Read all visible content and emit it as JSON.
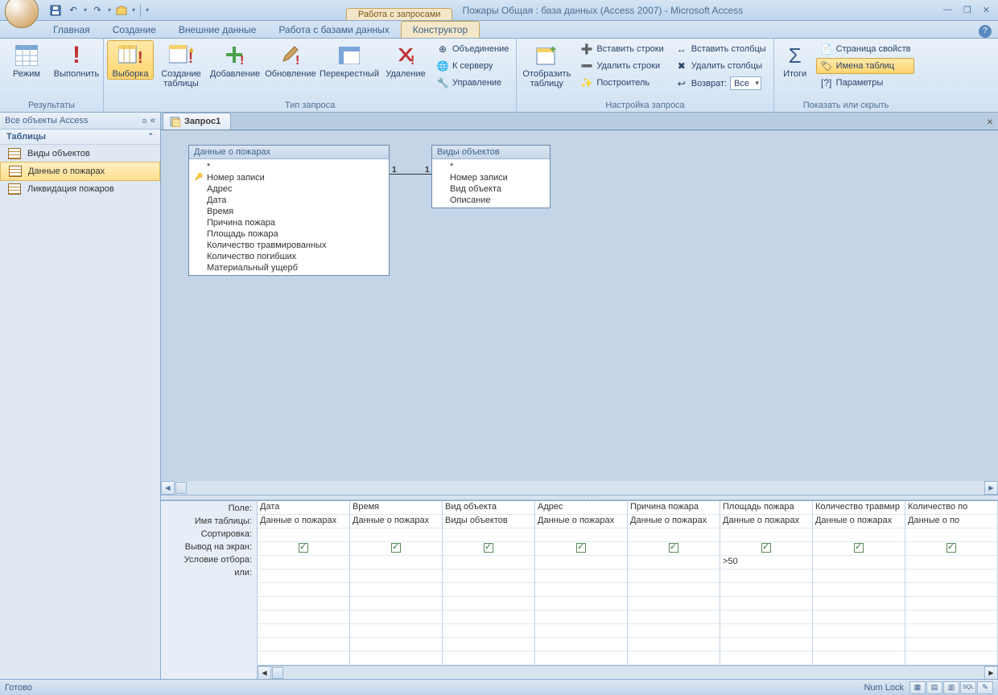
{
  "context_tab_label": "Работа с запросами",
  "app_title": "Пожары Общая : база данных (Access 2007) - Microsoft Access",
  "tabs": {
    "home": "Главная",
    "create": "Создание",
    "external": "Внешние данные",
    "dbtools": "Работа с базами данных",
    "design": "Конструктор"
  },
  "ribbon": {
    "results_group": "Результаты",
    "view": "Режим",
    "run": "Выполнить",
    "qtype_group": "Тип запроса",
    "select": "Выборка",
    "maketable": "Создание таблицы",
    "append": "Добавление",
    "update": "Обновление",
    "crosstab": "Перекрестный",
    "delete": "Удаление",
    "union": "Объединение",
    "passthrough": "К серверу",
    "datadef": "Управление",
    "setup_group": "Настройка запроса",
    "showtable": "Отобразить таблицу",
    "insrows": "Вставить строки",
    "delrows": "Удалить строки",
    "builder": "Построитель",
    "inscols": "Вставить столбцы",
    "delcols": "Удалить столбцы",
    "return_lbl": "Возврат:",
    "return_val": "Все",
    "totals": "Итоги",
    "propsheet": "Страница свойств",
    "tablenames": "Имена таблиц",
    "params": "Параметры",
    "showhide_group": "Показать или скрыть"
  },
  "nav": {
    "header": "Все объекты Access",
    "group": "Таблицы",
    "items": [
      "Виды объектов",
      "Данные о пожарах",
      "Ликвидация пожаров"
    ]
  },
  "doc_tab": "Запрос1",
  "table1": {
    "title": "Данные о пожарах",
    "fields": [
      "*",
      "Номер записи",
      "Адрес",
      "Дата",
      "Время",
      "Причина пожара",
      "Площадь пожара",
      "Количество травмированных",
      "Количество погибших",
      "Материальный ущерб"
    ]
  },
  "table2": {
    "title": "Виды объектов",
    "fields": [
      "*",
      "Номер записи",
      "Вид объекта",
      "Описание"
    ]
  },
  "rel_l": "1",
  "rel_r": "1",
  "qbe_labels": {
    "field": "Поле:",
    "table": "Имя таблицы:",
    "sort": "Сортировка:",
    "show": "Вывод на экран:",
    "criteria": "Условие отбора:",
    "or": "или:"
  },
  "qbe_cols": [
    {
      "field": "Дата",
      "table": "Данные о пожарах",
      "show": true,
      "criteria": ""
    },
    {
      "field": "Время",
      "table": "Данные о пожарах",
      "show": true,
      "criteria": ""
    },
    {
      "field": "Вид объекта",
      "table": "Виды объектов",
      "show": true,
      "criteria": ""
    },
    {
      "field": "Адрес",
      "table": "Данные о пожарах",
      "show": true,
      "criteria": ""
    },
    {
      "field": "Причина пожара",
      "table": "Данные о пожарах",
      "show": true,
      "criteria": ""
    },
    {
      "field": "Площадь пожара",
      "table": "Данные о пожарах",
      "show": true,
      "criteria": ">50"
    },
    {
      "field": "Количество травмир",
      "table": "Данные о пожарах",
      "show": true,
      "criteria": ""
    },
    {
      "field": "Количество по",
      "table": "Данные о по",
      "show": true,
      "criteria": ""
    }
  ],
  "status": {
    "ready": "Готово",
    "numlock": "Num Lock",
    "sql": "SQL"
  }
}
